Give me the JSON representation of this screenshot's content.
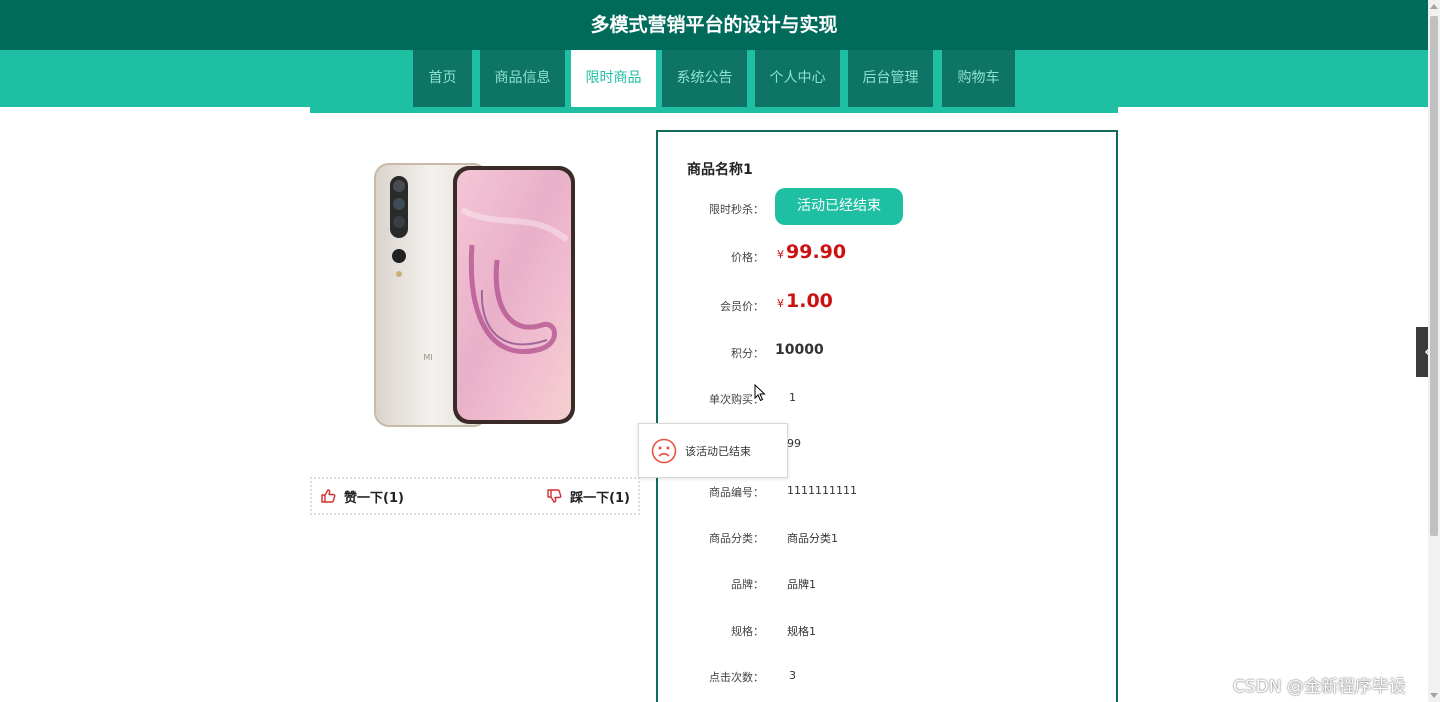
{
  "header": {
    "title": "多模式营销平台的设计与实现"
  },
  "nav": {
    "items": [
      {
        "label": "首页"
      },
      {
        "label": "商品信息"
      },
      {
        "label": "限时商品"
      },
      {
        "label": "系统公告"
      },
      {
        "label": "个人中心"
      },
      {
        "label": "后台管理"
      },
      {
        "label": "购物车"
      }
    ],
    "active": "限时商品"
  },
  "product": {
    "name": "商品名称1",
    "image_alt": "phone-product-photo",
    "votes": {
      "like_label": "赞一下(1)",
      "dislike_label": "踩一下(1)"
    },
    "flash_sale": {
      "label": "限时秒杀：",
      "button": "活动已经结束"
    },
    "price": {
      "label": "价格：",
      "currency": "¥",
      "value": "99.90"
    },
    "member_price": {
      "label": "会员价：",
      "currency": "¥",
      "value": "1.00"
    },
    "points": {
      "label": "积分：",
      "value": "10000"
    },
    "single_limit": {
      "label": "单次购买：",
      "value": "1"
    },
    "stock": {
      "value": "99"
    },
    "code": {
      "label": "商品编号：",
      "value": "1111111111"
    },
    "category": {
      "label": "商品分类：",
      "value": "商品分类1"
    },
    "brand": {
      "label": "品牌：",
      "value": "品牌1"
    },
    "spec": {
      "label": "规格：",
      "value": "规格1"
    },
    "clicks": {
      "label": "点击次数：",
      "value": "3"
    }
  },
  "toast": {
    "message": "该活动已结束"
  },
  "watermark": {
    "text": "CSDN @金新程序毕设"
  },
  "colors": {
    "header": "#006b5a",
    "accent": "#1fbfa3",
    "nav_item": "#0d7466",
    "price": "#cc1111"
  }
}
